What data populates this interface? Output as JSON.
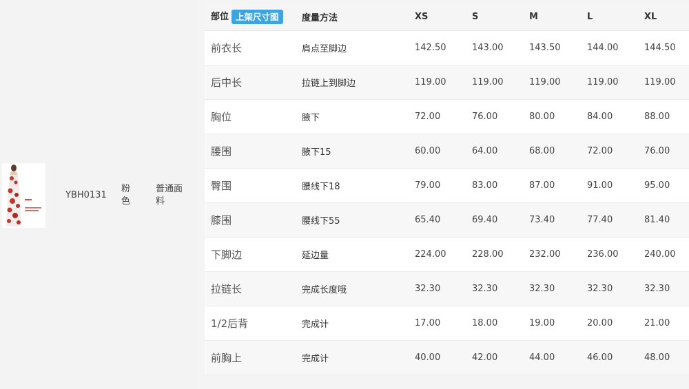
{
  "product": {
    "code": "YBH0131",
    "color": "粉色",
    "fabric": "普通面料",
    "image_alt": "dress-photo"
  },
  "table": {
    "header": {
      "part": "部位",
      "badge": "上架尺寸图",
      "method": "度量方法",
      "sizes": [
        "XS",
        "S",
        "M",
        "L",
        "XL"
      ]
    },
    "rows": [
      {
        "part": "前衣长",
        "method": "肩点至脚边",
        "values": [
          "142.50",
          "143.00",
          "143.50",
          "144.00",
          "144.50"
        ]
      },
      {
        "part": "后中长",
        "method": "拉链上到脚边",
        "values": [
          "119.00",
          "119.00",
          "119.00",
          "119.00",
          "119.00"
        ]
      },
      {
        "part": "胸位",
        "method": "腋下",
        "values": [
          "72.00",
          "76.00",
          "80.00",
          "84.00",
          "88.00"
        ]
      },
      {
        "part": "腰围",
        "method": "腋下15",
        "values": [
          "60.00",
          "64.00",
          "68.00",
          "72.00",
          "76.00"
        ]
      },
      {
        "part": "臀围",
        "method": "腰线下18",
        "values": [
          "79.00",
          "83.00",
          "87.00",
          "91.00",
          "95.00"
        ]
      },
      {
        "part": "膝围",
        "method": "腰线下55",
        "values": [
          "65.40",
          "69.40",
          "73.40",
          "77.40",
          "81.40"
        ]
      },
      {
        "part": "下脚边",
        "method": "延边量",
        "values": [
          "224.00",
          "228.00",
          "232.00",
          "236.00",
          "240.00"
        ]
      },
      {
        "part": "拉链长",
        "method": "完成长度哦",
        "values": [
          "32.30",
          "32.30",
          "32.30",
          "32.30",
          "32.30"
        ]
      },
      {
        "part": "1/2后背",
        "method": "完成计",
        "values": [
          "17.00",
          "18.00",
          "19.00",
          "20.00",
          "21.00"
        ]
      },
      {
        "part": "前胸上",
        "method": "完成计",
        "values": [
          "40.00",
          "42.00",
          "44.00",
          "46.00",
          "48.00"
        ]
      }
    ]
  },
  "colors": {
    "badge": "#3fa3e0",
    "header_bg": "#f5f5f5",
    "row_alt_bg": "#f7f7f7",
    "page_bg": "#f4f4f4"
  }
}
